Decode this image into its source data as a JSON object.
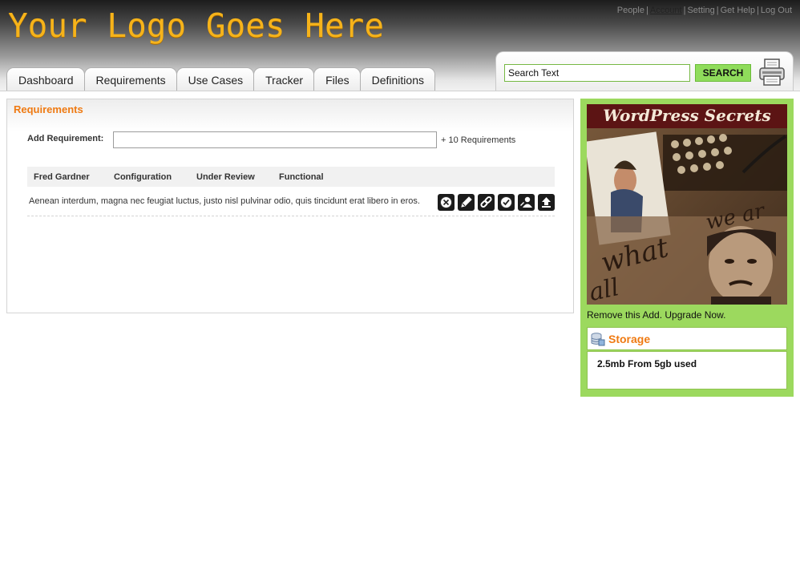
{
  "header": {
    "logo": "Your Logo Goes Here",
    "links": [
      "People",
      "Account",
      "Setting",
      "Get Help",
      "Log Out"
    ],
    "active_link": "Account"
  },
  "tabs": [
    "Dashboard",
    "Requirements",
    "Use Cases",
    "Tracker",
    "Files",
    "Definitions"
  ],
  "search": {
    "value": "Search Text",
    "button": "SEARCH"
  },
  "main": {
    "title": "Requirements",
    "add_label": "Add Requirement:",
    "add_value": "",
    "count_text": "+ 10 Requirements",
    "columns": [
      "Fred Gardner",
      "Configuration",
      "Under Review",
      "Functional"
    ],
    "row_text": "Aenean interdum, magna nec feugiat luctus, justo nisl pulvinar odio, quis tincidunt erat libero in eros.",
    "actions": [
      "delete-icon",
      "edit-icon",
      "link-icon",
      "approve-icon",
      "assign-user-icon",
      "upload-icon"
    ]
  },
  "sidebar": {
    "ad_title": "WordPress Secrets",
    "ad_remove": "Remove this Add. Upgrade Now.",
    "storage_title": "Storage",
    "storage_text": "2.5mb From 5gb used"
  },
  "colors": {
    "accent_orange": "#ef7a12",
    "logo_yellow": "#f6b31a",
    "sidebar_green": "#9cd95e",
    "search_button_green": "#8fdc5b"
  }
}
